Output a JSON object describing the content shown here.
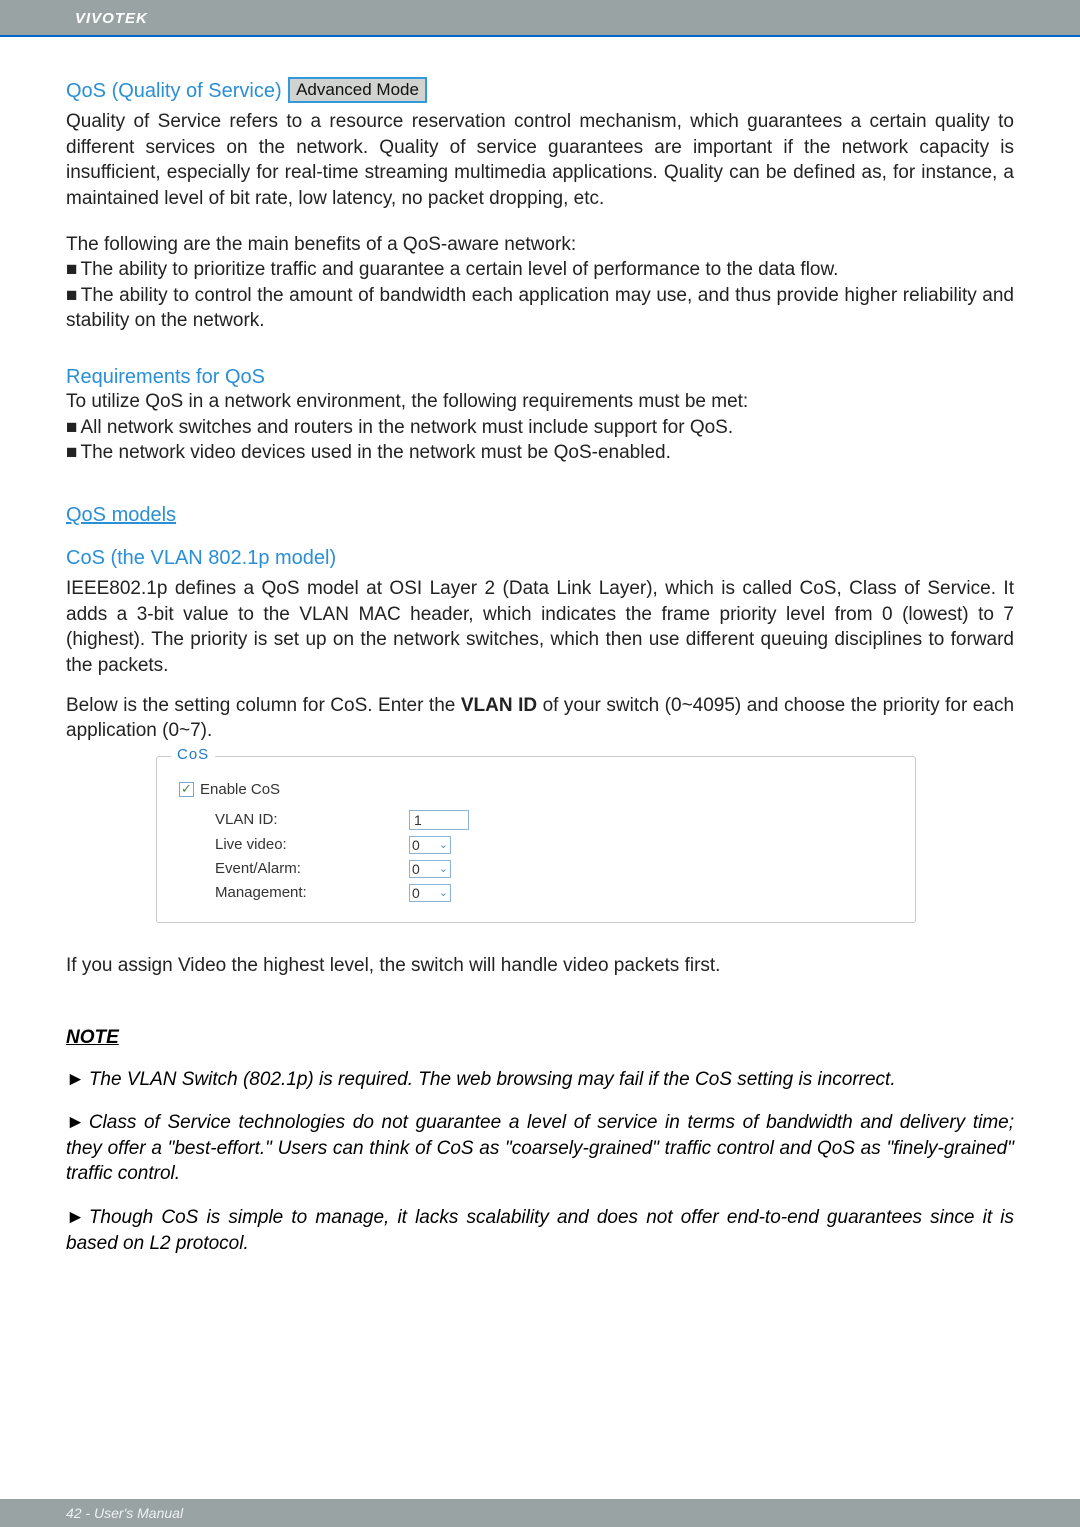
{
  "header": {
    "brand": "VIVOTEK"
  },
  "qos": {
    "title": "QoS (Quality of Service)",
    "badge": "Advanced Mode",
    "intro": "Quality of Service refers to a resource reservation control mechanism, which guarantees a certain quality to different services on the network. Quality of service guarantees are important if the network capacity is insufficient, especially for real-time streaming multimedia applications. Quality can be defined as, for instance, a maintained level of bit rate, low latency, no packet dropping, etc.",
    "benefits_lead": "The following are the main benefits of a QoS-aware network:",
    "benefits": [
      "The ability to prioritize traffic and guarantee a certain level of performance to the data flow.",
      "The ability to control the amount of bandwidth each application may use, and thus provide higher reliability and stability on the network."
    ]
  },
  "req": {
    "title": "Requirements for QoS",
    "lead": "To utilize QoS in a network environment, the following requirements must be met:",
    "items": [
      "All network switches and routers in the network must include support for QoS.",
      "The network video devices used in the network must be QoS-enabled."
    ]
  },
  "models": {
    "title": "QoS models"
  },
  "cos": {
    "title": "CoS (the VLAN 802.1p model)",
    "desc": "IEEE802.1p defines a QoS model at OSI Layer 2 (Data Link Layer), which is called CoS, Class of Service. It adds a 3-bit value to the VLAN MAC header, which indicates the frame priority level from 0 (lowest) to 7 (highest). The priority is set up on the network switches, which then use different queuing disciplines to forward the packets.",
    "below_pre": "Below is the setting column for CoS. Enter the ",
    "below_bold": "VLAN ID",
    "below_post": " of your switch (0~4095) and choose the priority for each application (0~7).",
    "after_panel": "If you assign Video the highest level, the switch will handle video packets first."
  },
  "panel": {
    "legend": "CoS",
    "enable_label": "Enable CoS",
    "vlan_label": "VLAN ID:",
    "vlan_value": "1",
    "live_label": "Live video:",
    "live_value": "0",
    "event_label": "Event/Alarm:",
    "event_value": "0",
    "mgmt_label": "Management:",
    "mgmt_value": "0"
  },
  "note": {
    "title": "NOTE",
    "items": [
      "The VLAN Switch (802.1p) is required.  The web browsing may fail if the CoS setting is incorrect.",
      "Class of Service technologies do not guarantee a level of service in terms of bandwidth and delivery time; they offer a \"best-effort.\" Users can think of CoS as \"coarsely-grained\" traffic control and QoS as \"finely-grained\" traffic control.",
      "Though CoS is simple to manage, it lacks scalability and does not offer end-to-end guarantees since it is based on L2 protocol."
    ]
  },
  "footer": {
    "text": "42 - User's Manual"
  }
}
